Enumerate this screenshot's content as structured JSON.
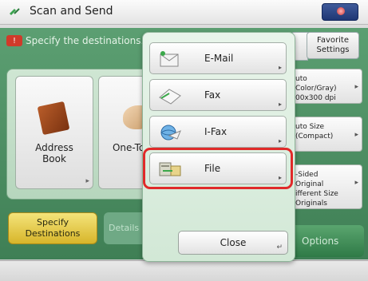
{
  "window": {
    "title": "Scan and Send"
  },
  "instruction": "Specify the destinations.",
  "destination_buttons": [
    {
      "label": "Address\nBook"
    },
    {
      "label": "One-Touch"
    }
  ],
  "tabs": {
    "specify": "Specify\nDestinations",
    "details": "Details"
  },
  "favorite_settings": "Favorite\nSettings",
  "settings": [
    {
      "text": "uto\nColor/Gray)",
      "text2": "00x300 dpi"
    },
    {
      "text": "uto Size",
      "text2": "(Compact)"
    },
    {
      "text": "-Sided\nOriginal",
      "text2": "ifferent Size\nOriginals"
    }
  ],
  "options_label": "Options",
  "popup": {
    "items": [
      {
        "label": "E-Mail"
      },
      {
        "label": "Fax"
      },
      {
        "label": "I-Fax"
      },
      {
        "label": "File",
        "selected": true
      }
    ],
    "close_label": "Close"
  },
  "colors": {
    "accent_green": "#3f7f55",
    "highlight": "#e02a2a",
    "selected_tab": "#d7b52a"
  }
}
